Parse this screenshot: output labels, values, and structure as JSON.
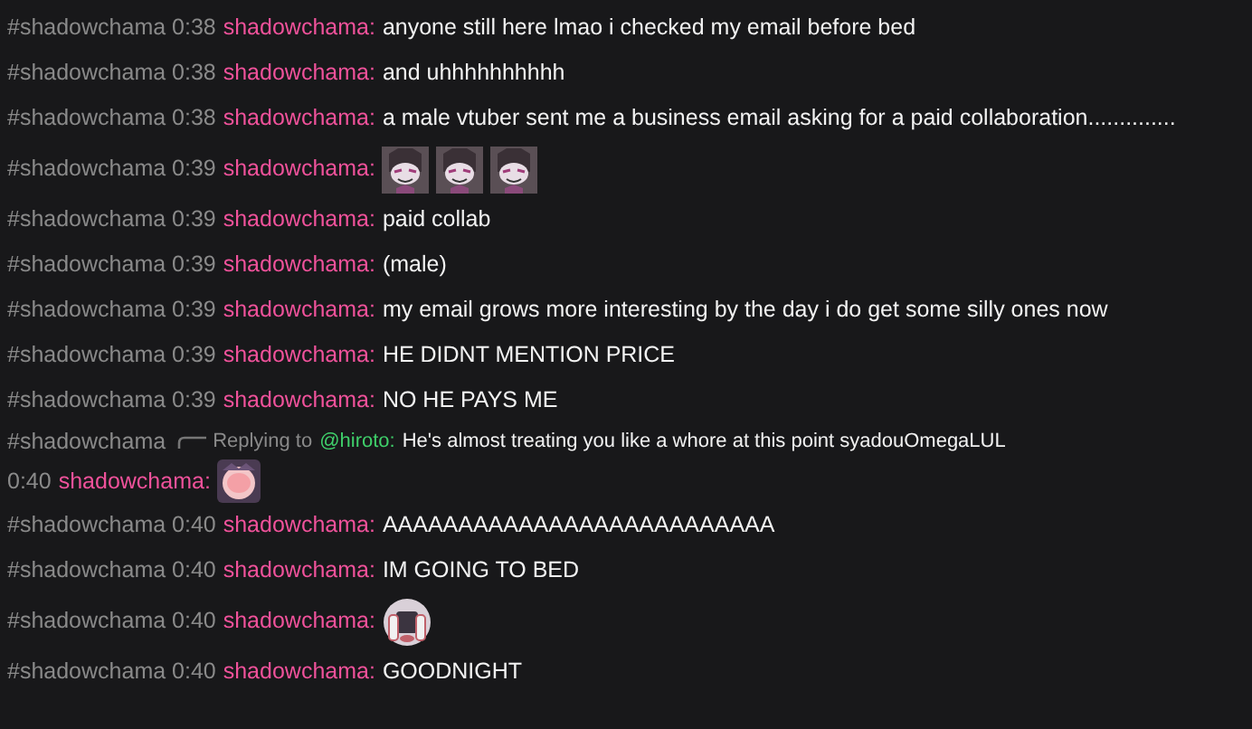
{
  "messages": [
    {
      "channel": "#shadowchama",
      "time": "0:38",
      "user": "shadowchama:",
      "text": "anyone still here lmao i checked my email before bed"
    },
    {
      "channel": "#shadowchama",
      "time": "0:38",
      "user": "shadowchama:",
      "text": "and uhhhhhhhhhh"
    },
    {
      "channel": "#shadowchama",
      "time": "0:38",
      "user": "shadowchama:",
      "text": "a male vtuber sent me a business email asking for a paid collaboration.............."
    },
    {
      "channel": "#shadowchama",
      "time": "0:39",
      "user": "shadowchama:",
      "emotes": [
        {
          "kind": "grin"
        },
        {
          "kind": "grin"
        },
        {
          "kind": "grin"
        }
      ]
    },
    {
      "channel": "#shadowchama",
      "time": "0:39",
      "user": "shadowchama:",
      "text": "paid collab"
    },
    {
      "channel": "#shadowchama",
      "time": "0:39",
      "user": "shadowchama:",
      "text": "(male)"
    },
    {
      "channel": "#shadowchama",
      "time": "0:39",
      "user": "shadowchama:",
      "text": "my email grows more interesting by the day i do get some silly ones now"
    },
    {
      "channel": "#shadowchama",
      "time": "0:39",
      "user": "shadowchama:",
      "text": "HE DIDNT MENTION PRICE"
    },
    {
      "channel": "#shadowchama",
      "time": "0:39",
      "user": "shadowchama:",
      "text": "NO HE PAYS ME"
    },
    {
      "channel": "#shadowchama",
      "reply": {
        "label": "Replying to",
        "to": "@hiroto:",
        "text": "He's almost treating you like a whore at this point syadouOmegaLUL"
      },
      "time": "0:40",
      "user": "shadowchama:",
      "emotes": [
        {
          "kind": "blush"
        }
      ]
    },
    {
      "channel": "#shadowchama",
      "time": "0:40",
      "user": "shadowchama:",
      "text": "AAAAAAAAAAAAAAAAAAAAAAAAAA"
    },
    {
      "channel": "#shadowchama",
      "time": "0:40",
      "user": "shadowchama:",
      "text": "IM GOING TO BED"
    },
    {
      "channel": "#shadowchama",
      "time": "0:40",
      "user": "shadowchama:",
      "emotes": [
        {
          "kind": "hug"
        }
      ]
    },
    {
      "channel": "#shadowchama",
      "time": "0:40",
      "user": "shadowchama:",
      "text": "GOODNIGHT"
    }
  ]
}
